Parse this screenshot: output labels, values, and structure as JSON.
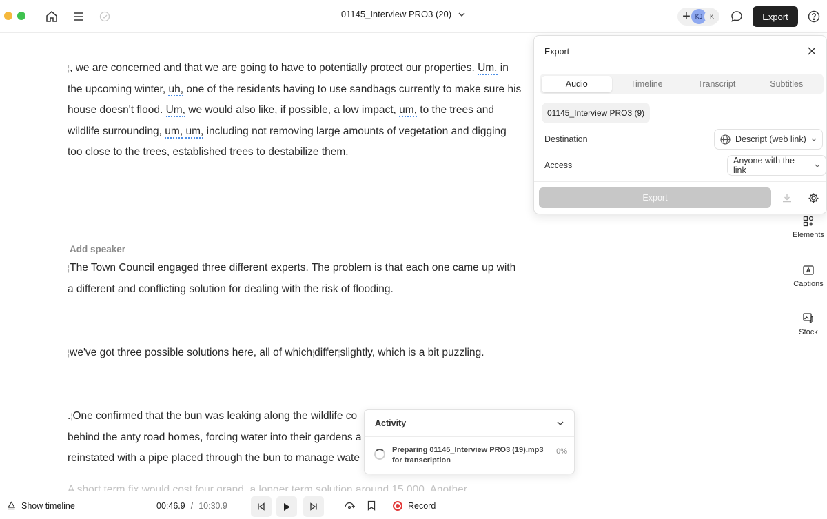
{
  "titlebar": {
    "document_title": "01145_Interview PRO3 (20)",
    "avatar_primary": "KJ",
    "avatar_secondary": "K",
    "export_label": "Export"
  },
  "transcript": {
    "para1": {
      "t1": ", we are concerned and that we are going to have to potentially protect our properties. ",
      "f1": "Um,",
      "t2": " in the upcoming winter, ",
      "f2": "uh,",
      "t3": " one of the residents having to use sandbags currently to make sure his house doesn't flood. ",
      "f3": "Um,",
      "t4": " we would also like, if possible, a low impact, ",
      "f4": "um,",
      "t5": " to the trees and wildlife surrounding, ",
      "f5": "um,",
      "t6": " ",
      "f6": "um,",
      "t7": " including not removing large amounts of vegetation and digging too close to the trees, established trees to destabilize them."
    },
    "speaker_label": "Add speaker",
    "para2": "The Town Council engaged three different experts. The problem is that each one came up with a different and conflicting solution for dealing with the risk of flooding.",
    "para3": {
      "a": "we've got three possible solutions here, all of which",
      "b": "differ",
      "c": "slightly, which is a bit puzzling."
    },
    "para4": {
      "lead": ".",
      "line1": "One confirmed that the bun was leaking along the wildlife co",
      "line2": "behind the anty road homes, forcing water into their gardens a",
      "line3": "reinstated with a pipe placed through the bun to manage wate"
    },
    "para5": "A short term fix would cost four grand, a longer term solution around 15,000. Another"
  },
  "side_tools": [
    {
      "label": "Elements",
      "icon": "elements-icon"
    },
    {
      "label": "Captions",
      "icon": "captions-icon"
    },
    {
      "label": "Stock",
      "icon": "stock-media-icon"
    }
  ],
  "export_panel": {
    "title": "Export",
    "tabs": [
      "Audio",
      "Timeline",
      "Transcript",
      "Subtitles"
    ],
    "active_tab": "Audio",
    "file_name": "01145_Interview PRO3 (9)",
    "destination_label": "Destination",
    "destination_value": "Descript (web link)",
    "access_label": "Access",
    "access_value": "Anyone with the link",
    "export_button": "Export"
  },
  "activity": {
    "title": "Activity",
    "message": "Preparing 01145_Interview PRO3 (19).mp3 for transcription",
    "progress_text": "0%"
  },
  "playback": {
    "show_timeline_label": "Show timeline",
    "current_time": "00:46.9",
    "separator": "/",
    "total_time": "10:30.9",
    "record_label": "Record"
  },
  "colors": {
    "accent_filler_underline": "#4d8fe6",
    "record_red": "#e23a3a",
    "export_dark": "#222222"
  }
}
